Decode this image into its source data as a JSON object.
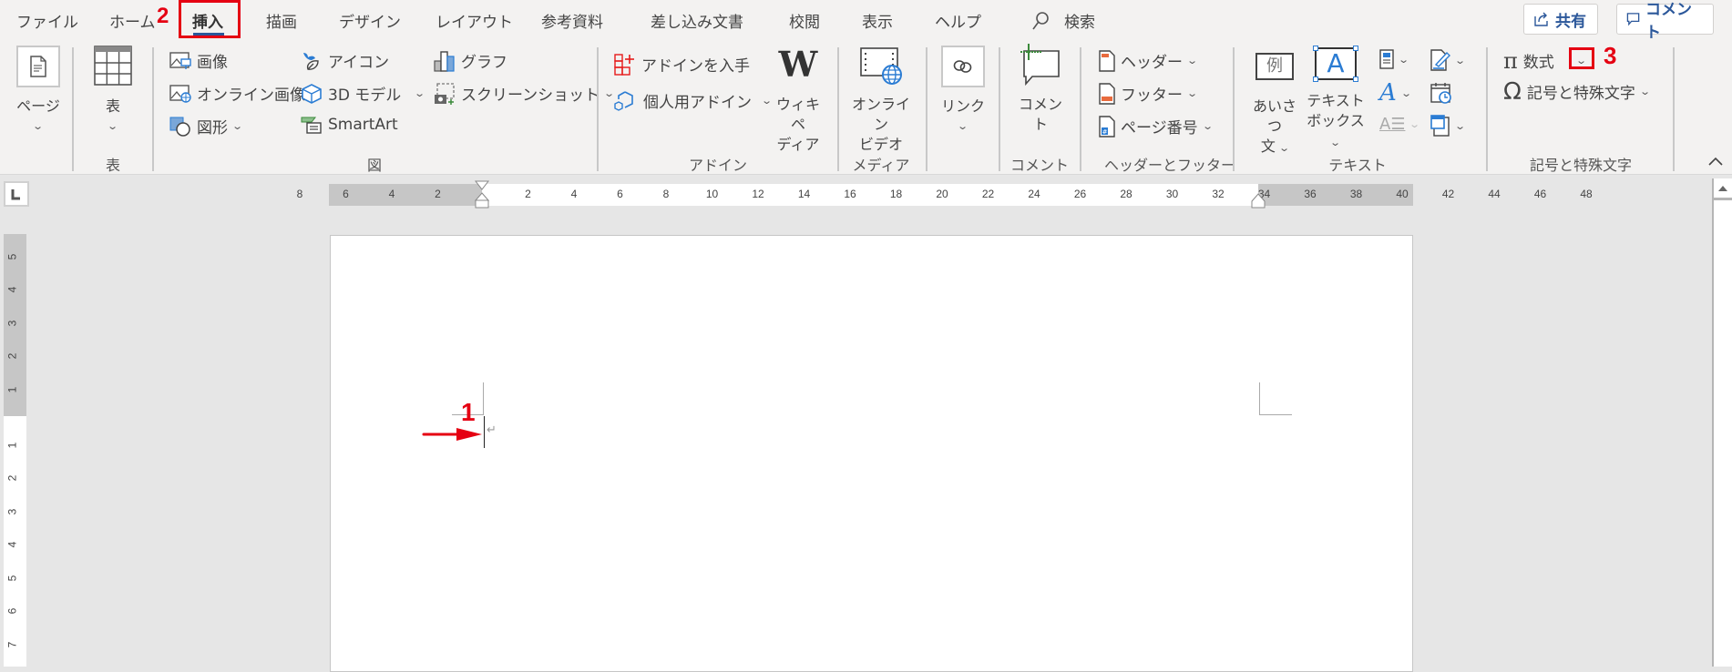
{
  "tabs": [
    {
      "label": "ファイル"
    },
    {
      "label": "ホーム"
    },
    {
      "label": "挿入",
      "active": true
    },
    {
      "label": "描画"
    },
    {
      "label": "デザイン"
    },
    {
      "label": "レイアウト"
    },
    {
      "label": "参考資料"
    },
    {
      "label": "差し込み文書"
    },
    {
      "label": "校閲"
    },
    {
      "label": "表示"
    },
    {
      "label": "ヘルプ"
    }
  ],
  "search": {
    "label": "検索",
    "icon": "search-icon"
  },
  "top_buttons": {
    "share": "共有",
    "comment": "コメント"
  },
  "annotations": {
    "step1": "1",
    "step2": "2",
    "step3": "3",
    "highlight_color": "#e50012"
  },
  "ribbon": {
    "pages": {
      "label": "ページ"
    },
    "table": {
      "label": "表",
      "group": "表"
    },
    "illustrations": {
      "group": "図",
      "picture": "画像",
      "online_picture": "オンライン画像",
      "shapes": "図形",
      "icons": "アイコン",
      "models_3d": "3D モデル",
      "smartart": "SmartArt",
      "chart": "グラフ",
      "screenshot": "スクリーンショット"
    },
    "addins": {
      "group": "アドイン",
      "get_addins": "アドインを入手",
      "my_addins": "個人用アドイン",
      "wikipedia_line1": "ウィキペ",
      "wikipedia_line2": "ディア"
    },
    "media": {
      "group": "メディア",
      "online_video_line1": "オンライン",
      "online_video_line2": "ビデオ"
    },
    "links": {
      "label": "リンク"
    },
    "comments": {
      "group": "コメント",
      "comment": "コメント"
    },
    "header_footer": {
      "group": "ヘッダーとフッター",
      "header": "ヘッダー",
      "footer": "フッター",
      "page_number": "ページ番号"
    },
    "text": {
      "group": "テキスト",
      "greeting_line1": "あいさつ",
      "greeting_line2": "文",
      "textbox_line1": "テキスト",
      "textbox_line2": "ボックス",
      "greeting_icon_char": "例",
      "textbox_icon_char": "A"
    },
    "symbols": {
      "group": "記号と特殊文字",
      "equation": "数式",
      "symbol": "記号と特殊文字",
      "pi_char": "π",
      "omega_char": "Ω"
    }
  },
  "ruler": {
    "horizontal_left_labels": [
      "8",
      "6",
      "4",
      "2"
    ],
    "horizontal_labels": [
      "2",
      "4",
      "6",
      "8",
      "10",
      "12",
      "14",
      "16",
      "18",
      "20",
      "22",
      "24",
      "26",
      "28",
      "30",
      "32",
      "34",
      "36",
      "38",
      "40",
      "42",
      "44",
      "46",
      "48"
    ],
    "vertical_top_labels": [
      "5",
      "4",
      "3",
      "2",
      "1"
    ],
    "vertical_labels": [
      "1",
      "2",
      "3",
      "4",
      "5",
      "6",
      "7"
    ]
  },
  "document": {
    "paragraph_mark": "↵"
  }
}
